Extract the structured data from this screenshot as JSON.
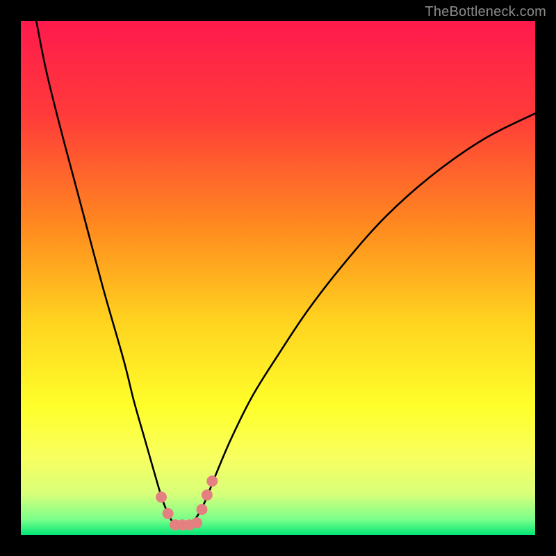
{
  "watermark": "TheBottleneck.com",
  "chart_data": {
    "type": "line",
    "title": "",
    "xlabel": "",
    "ylabel": "",
    "xlim": [
      0,
      100
    ],
    "ylim": [
      0,
      100
    ],
    "background_gradient": {
      "orientation": "vertical",
      "stops": [
        {
          "offset": 0.0,
          "color": "#ff1a4d"
        },
        {
          "offset": 0.18,
          "color": "#ff3a3a"
        },
        {
          "offset": 0.4,
          "color": "#ff8a1f"
        },
        {
          "offset": 0.58,
          "color": "#ffd21f"
        },
        {
          "offset": 0.75,
          "color": "#ffff2a"
        },
        {
          "offset": 0.85,
          "color": "#f8ff60"
        },
        {
          "offset": 0.92,
          "color": "#d8ff7a"
        },
        {
          "offset": 0.97,
          "color": "#79ff8a"
        },
        {
          "offset": 1.0,
          "color": "#00e676"
        }
      ]
    },
    "series": [
      {
        "name": "bottleneck-curve",
        "color": "#000000",
        "x": [
          3,
          5,
          8,
          12,
          16,
          20,
          22,
          24,
          26,
          27.5,
          28.8,
          30,
          31.2,
          32.4,
          33.6,
          34.8,
          36,
          38,
          41,
          45,
          50,
          56,
          63,
          71,
          80,
          90,
          100
        ],
        "y": [
          100,
          90,
          78,
          63,
          48,
          34,
          26,
          19,
          12,
          7,
          3.8,
          2,
          2,
          2,
          2.8,
          4.5,
          7,
          12,
          19,
          27,
          35,
          44,
          53,
          62,
          70,
          77,
          82
        ]
      }
    ],
    "markers": {
      "name": "highlighted-points",
      "color": "#e58080",
      "radius": 8,
      "points": [
        {
          "x": 27.3,
          "y": 7.4
        },
        {
          "x": 28.6,
          "y": 4.2
        },
        {
          "x": 30.0,
          "y": 2.0
        },
        {
          "x": 31.4,
          "y": 2.0
        },
        {
          "x": 32.8,
          "y": 2.0
        },
        {
          "x": 34.2,
          "y": 2.4
        },
        {
          "x": 35.2,
          "y": 5.0
        },
        {
          "x": 36.2,
          "y": 7.8
        },
        {
          "x": 37.2,
          "y": 10.5
        }
      ]
    }
  }
}
